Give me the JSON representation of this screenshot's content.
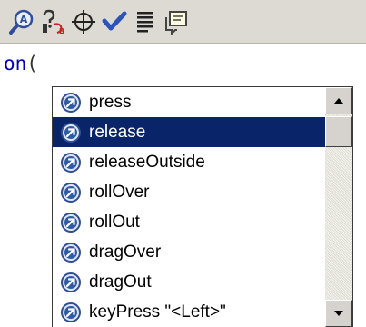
{
  "toolbar": {
    "buttons": [
      {
        "icon": "add-statement-icon"
      },
      {
        "icon": "find-replace-icon"
      },
      {
        "icon": "insert-target-path-icon"
      },
      {
        "icon": "check-syntax-icon"
      },
      {
        "icon": "auto-format-icon"
      },
      {
        "icon": "show-code-hint-icon"
      }
    ]
  },
  "code": {
    "text": "on",
    "paren": "("
  },
  "popup": {
    "items": [
      {
        "label": "press"
      },
      {
        "label": "release"
      },
      {
        "label": "releaseOutside"
      },
      {
        "label": "rollOver"
      },
      {
        "label": "rollOut"
      },
      {
        "label": "dragOver"
      },
      {
        "label": "dragOut"
      },
      {
        "label": "keyPress \"<Left>\""
      }
    ],
    "selected_label": "release"
  },
  "colors": {
    "selection": "#0a246a",
    "icon_blue": "#2f5aa8",
    "code_text": "#0000b4"
  }
}
